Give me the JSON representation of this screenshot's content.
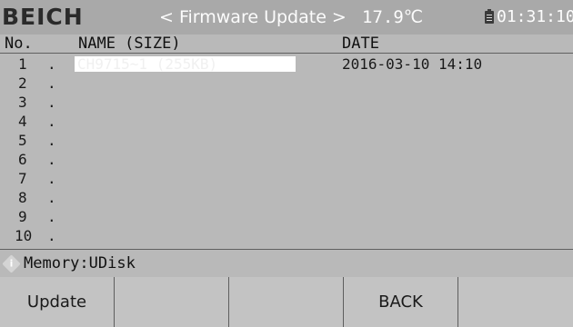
{
  "topbar": {
    "logo": "BEICH",
    "title": "< Firmware Update >",
    "temperature": "17.9℃",
    "clock": "01:31:10",
    "battery_icon": "battery-icon"
  },
  "columns": {
    "no": "No.",
    "name": "NAME (SIZE)",
    "date": "DATE"
  },
  "files": [
    {
      "num": "1",
      "dot": ".",
      "name": "CH9715~1 (255KB)",
      "date": "2016-03-10 14:10"
    },
    {
      "num": "2",
      "dot": ".",
      "name": "",
      "date": ""
    },
    {
      "num": "3",
      "dot": ".",
      "name": "",
      "date": ""
    },
    {
      "num": "4",
      "dot": ".",
      "name": "",
      "date": ""
    },
    {
      "num": "5",
      "dot": ".",
      "name": "",
      "date": ""
    },
    {
      "num": "6",
      "dot": ".",
      "name": "",
      "date": ""
    },
    {
      "num": "7",
      "dot": ".",
      "name": "",
      "date": ""
    },
    {
      "num": "8",
      "dot": ".",
      "name": "",
      "date": ""
    },
    {
      "num": "9",
      "dot": ".",
      "name": "",
      "date": ""
    },
    {
      "num": "10",
      "dot": ".",
      "name": "",
      "date": ""
    }
  ],
  "memory": {
    "icon": "i",
    "text": "Memory:UDisk"
  },
  "softkeys": [
    "Update",
    "",
    "",
    "BACK",
    ""
  ],
  "colors": {
    "background": "#b9b9b9",
    "topbar": "#a9a9a9",
    "selected_row": "#ffffff"
  }
}
